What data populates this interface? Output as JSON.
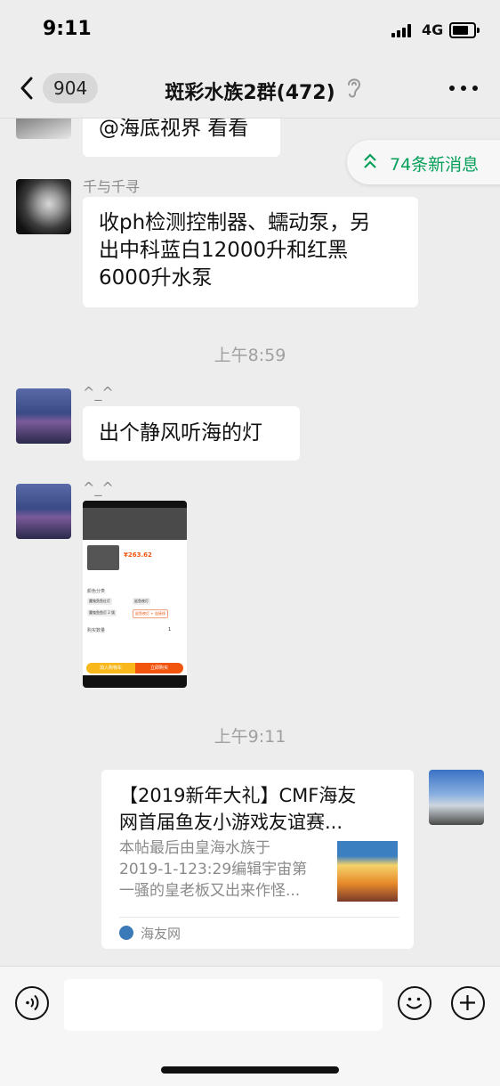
{
  "status_bar": {
    "time": "9:11",
    "network": "4G"
  },
  "nav": {
    "back_count": "904",
    "title": "斑彩水族2群(472)"
  },
  "new_messages": {
    "label": "74条新消息"
  },
  "messages": [
    {
      "type": "text",
      "text": "@海底视界 看看"
    },
    {
      "type": "text",
      "sender": "千与千寻",
      "lines": [
        "收ph检测控制器、蠕动泵，另",
        "出中科蓝白12000升和红黑",
        "6000升水泵"
      ]
    },
    {
      "type": "time",
      "text": "上午8:59"
    },
    {
      "type": "text",
      "sender": "^_^",
      "text": "出个静风听海的灯"
    },
    {
      "type": "image",
      "sender": "^_^",
      "screenshot": {
        "price": "¥263.62",
        "section_label": "颜色分类",
        "options": [
          "魔鬼鱼鱼红灯",
          "鲨鱼夜灯",
          "魔鬼鱼鱼灯 2 版",
          "鲨鱼夜灯 + 连接线"
        ],
        "qty_label": "购买数量",
        "qty_value": "1",
        "cart_label": "加入购物车",
        "buy_label": "立即购买"
      }
    },
    {
      "type": "time",
      "text": "上午9:11"
    },
    {
      "type": "link",
      "title_lines": [
        "【2019新年大礼】CMF海友",
        "网首届鱼友小游戏友谊赛..."
      ],
      "desc_lines": [
        "本帖最后由皇海水族于",
        "2019-1-123:29编辑宇宙第",
        "一骚的皇老板又出来作怪..."
      ],
      "source": "海友网"
    }
  ],
  "icons": {
    "back": "chevron-left-icon",
    "ear": "ear-icon",
    "more": "more-icon",
    "new_msg": "double-chevron-up-icon",
    "voice": "voice-icon",
    "emoji": "emoji-icon",
    "add": "plus-icon"
  },
  "colors": {
    "background": "#ededed",
    "new_msg_accent": "#07a05a",
    "bubble": "#ffffff"
  }
}
